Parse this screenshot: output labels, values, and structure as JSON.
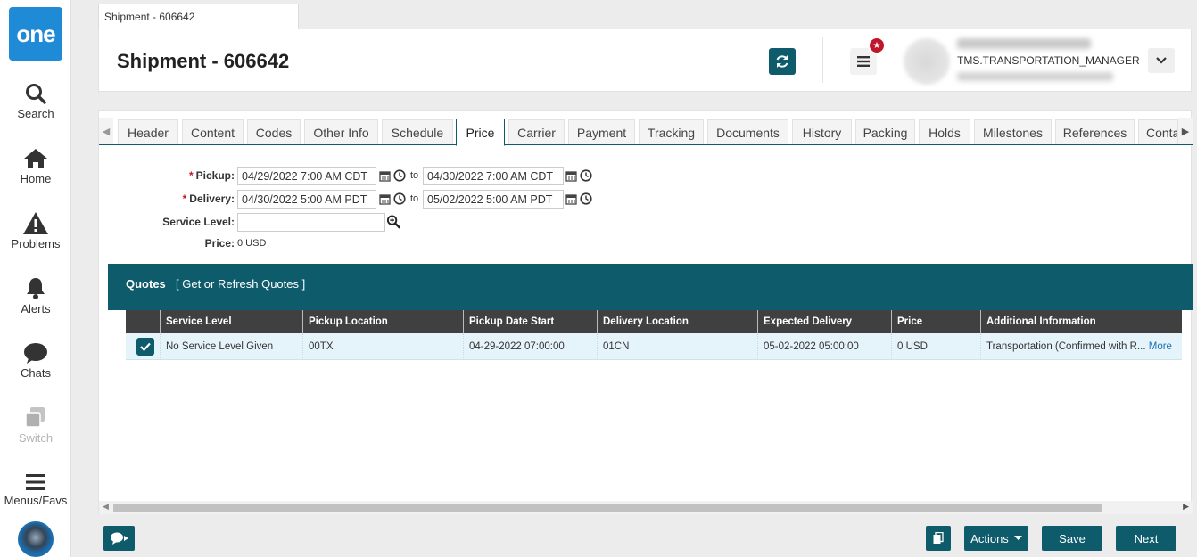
{
  "app": {
    "logo": "one"
  },
  "nav": [
    {
      "label": "Search",
      "icon": "search-icon"
    },
    {
      "label": "Home",
      "icon": "home-icon"
    },
    {
      "label": "Problems",
      "icon": "warning-icon"
    },
    {
      "label": "Alerts",
      "icon": "bell-icon"
    },
    {
      "label": "Chats",
      "icon": "chat-icon"
    },
    {
      "label": "Switch",
      "icon": "switch-icon"
    },
    {
      "label": "Menus/Favs",
      "icon": "menu-icon"
    }
  ],
  "doc_tab": "Shipment - 606642",
  "page_title": "Shipment - 606642",
  "user": {
    "role": "TMS.TRANSPORTATION_MANAGER",
    "notification_count": "★"
  },
  "tabs": [
    "Header",
    "Content",
    "Codes",
    "Other Info",
    "Schedule",
    "Price",
    "Carrier",
    "Payment",
    "Tracking",
    "Documents",
    "History",
    "Packing",
    "Holds",
    "Milestones",
    "References",
    "Conta"
  ],
  "active_tab": "Price",
  "form": {
    "pickup_label": "Pickup:",
    "pickup_from": "04/29/2022 7:00 AM CDT",
    "pickup_to": "04/30/2022 7:00 AM CDT",
    "delivery_label": "Delivery:",
    "delivery_from": "04/30/2022 5:00 AM PDT",
    "delivery_to": "05/02/2022 5:00 AM PDT",
    "to": "to",
    "required_mark": "*",
    "service_level_label": "Service Level:",
    "service_level_value": "",
    "price_label": "Price:",
    "price_value": "0 USD"
  },
  "quotes": {
    "title": "Quotes",
    "link": "[ Get or Refresh Quotes ]",
    "columns": [
      "Service Level",
      "Pickup Location",
      "Pickup Date Start",
      "Delivery Location",
      "Expected Delivery",
      "Price",
      "Additional Information"
    ],
    "rows": [
      {
        "service_level": "No Service Level Given",
        "pickup_location": "00TX",
        "pickup_date_start": "04-29-2022 07:00:00",
        "delivery_location": "01CN",
        "expected_delivery": "05-02-2022 05:00:00",
        "price": "0 USD",
        "additional_information": "Transportation (Confirmed with R...",
        "more": "More"
      }
    ]
  },
  "buttons": {
    "actions": "Actions",
    "save": "Save",
    "next": "Next"
  },
  "colors": {
    "primary": "#0d5b6b",
    "logo": "#1f8ad6",
    "badge": "#c0152b"
  }
}
